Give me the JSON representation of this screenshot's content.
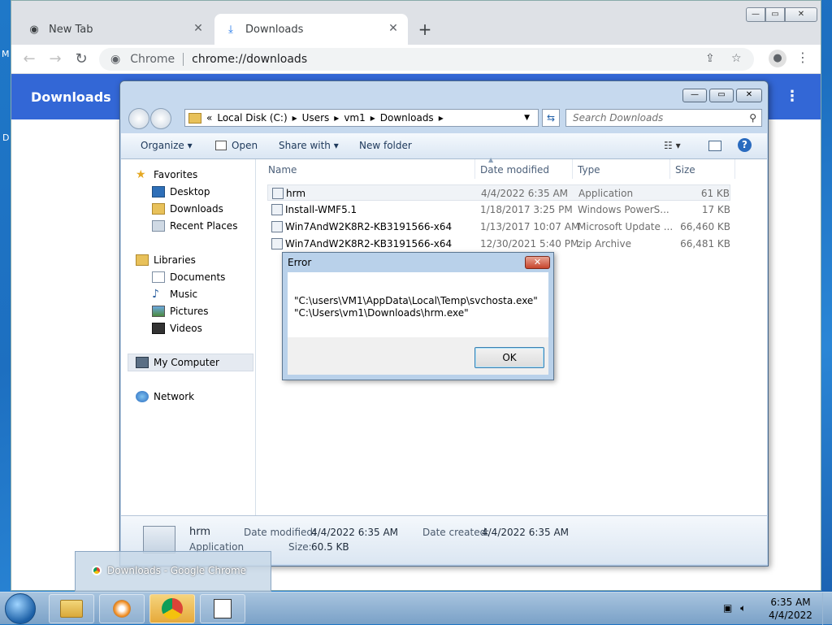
{
  "desktop": {
    "glyph_m": "M",
    "glyph_d": "D"
  },
  "chrome": {
    "tabs": [
      {
        "title": "New Tab",
        "close": "✕"
      },
      {
        "title": "Downloads",
        "close": "✕"
      }
    ],
    "new_tab_label": "+",
    "window_buttons": {
      "minimize": "—",
      "maximize": "▭",
      "close": "✕"
    },
    "omnibox": {
      "site": "Chrome",
      "url": "chrome://downloads"
    },
    "page_title": "Downloads",
    "menu": "⋮",
    "more": "⋮"
  },
  "explorer": {
    "window_buttons": {
      "minimize": "—",
      "maximize": "▭",
      "close": "✕"
    },
    "breadcrumb": [
      "«",
      "Local Disk (C:)",
      "▸",
      "Users",
      "▸",
      "vm1",
      "▸",
      "Downloads",
      "▸"
    ],
    "search_placeholder": "Search Downloads",
    "commands": {
      "organize": "Organize ▾",
      "open": "Open",
      "share": "Share with ▾",
      "new_folder": "New folder"
    },
    "nav": {
      "favorites": "Favorites",
      "desktop": "Desktop",
      "downloads": "Downloads",
      "recent": "Recent Places",
      "libraries": "Libraries",
      "documents": "Documents",
      "music": "Music",
      "pictures": "Pictures",
      "videos": "Videos",
      "computer": "My Computer",
      "network": "Network"
    },
    "columns": {
      "name": "Name",
      "date": "Date modified",
      "type": "Type",
      "size": "Size"
    },
    "files": [
      {
        "name": "hrm",
        "date": "4/4/2022 6:35 AM",
        "type": "Application",
        "size": "61 KB"
      },
      {
        "name": "Install-WMF5.1",
        "date": "1/18/2017 3:25 PM",
        "type": "Windows PowerS...",
        "size": "17 KB"
      },
      {
        "name": "Win7AndW2K8R2-KB3191566-x64",
        "date": "1/13/2017 10:07 AM",
        "type": "Microsoft Update ...",
        "size": "66,460 KB"
      },
      {
        "name": "Win7AndW2K8R2-KB3191566-x64",
        "date": "12/30/2021 5:40 PM",
        "type": "zip Archive",
        "size": "66,481 KB"
      }
    ],
    "details": {
      "name": "hrm",
      "kind": "Application",
      "modified_label": "Date modified:",
      "modified": "4/4/2022 6:35 AM",
      "created_label": "Date created:",
      "created": "4/4/2022 6:35 AM",
      "size_label": "Size:",
      "size": "60.5 KB"
    }
  },
  "dialog": {
    "title": "Error",
    "close": "✕",
    "line1": "\"C:\\users\\VM1\\AppData\\Local\\Temp\\svchosta.exe\"",
    "line2": "\"C:\\Users\\vm1\\Downloads\\hrm.exe\"",
    "ok": "OK"
  },
  "taskbar": {
    "thumbnail": "Downloads - Google Chrome",
    "time": "6:35 AM",
    "date": "4/4/2022"
  }
}
